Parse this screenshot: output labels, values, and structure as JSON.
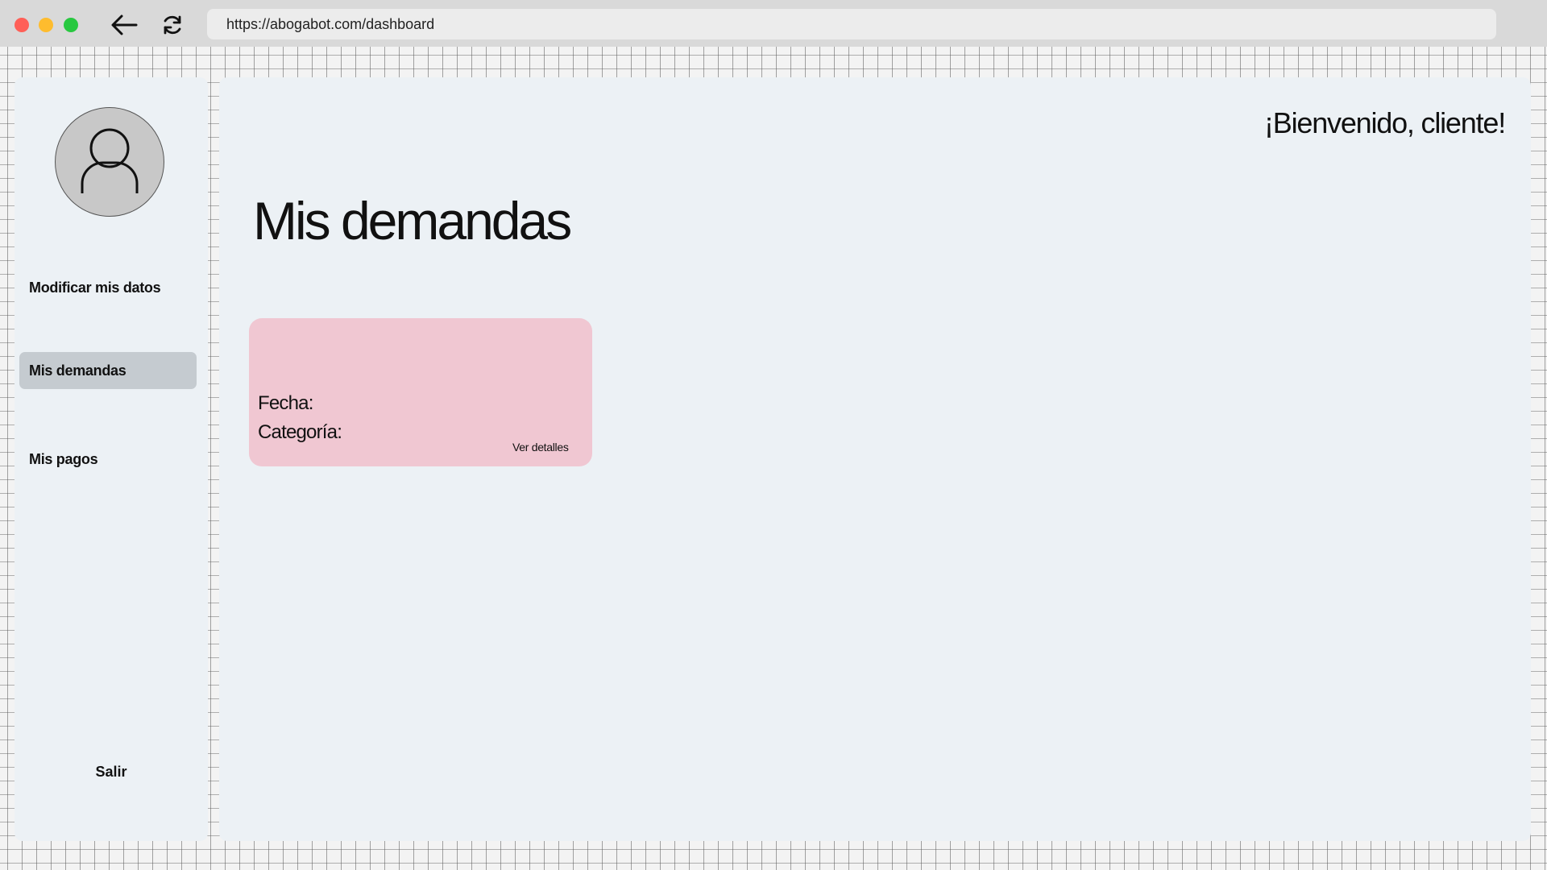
{
  "browser": {
    "url": "https://abogabot.com/dashboard"
  },
  "sidebar": {
    "items": [
      {
        "label": "Modificar mis datos"
      },
      {
        "label": "Mis demandas"
      },
      {
        "label": "Mis pagos"
      }
    ],
    "logout_label": "Salir"
  },
  "header": {
    "welcome": "¡Bienvenido, cliente!"
  },
  "main": {
    "title": "Mis demandas",
    "cards": [
      {
        "date_label": "Fecha:",
        "category_label": "Categoría:",
        "details_link": "Ver detalles"
      }
    ]
  },
  "colors": {
    "card_background": "#f0c7d2",
    "active_nav": "#c5cbd0",
    "panel_background": "#ecf1f5"
  }
}
